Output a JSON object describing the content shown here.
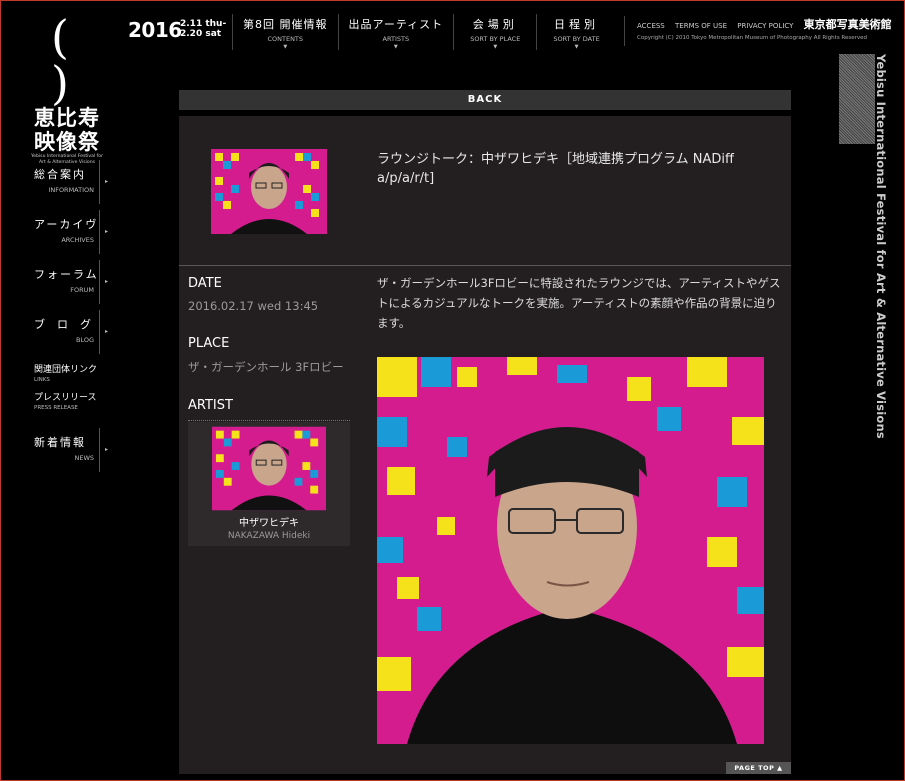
{
  "logo": {
    "paren": "( )",
    "jp_line1": "恵比寿",
    "jp_line2": "映像祭",
    "en_line1": "Yebisu International Festival for",
    "en_line2": "Art & Alternative Visions"
  },
  "top": {
    "year": "2016",
    "dates_line1": "2.11 thu-",
    "dates_line2": "2.20 sat",
    "nav": [
      {
        "jp": "第8回 開催情報",
        "en": "CONTENTS"
      },
      {
        "jp": "出品アーティスト",
        "en": "ARTISTS"
      },
      {
        "jp": "会場別",
        "en": "SORT BY PLACE"
      },
      {
        "jp": "日程別",
        "en": "SORT BY DATE"
      }
    ],
    "links": {
      "access": "ACCESS",
      "terms": "TERMS OF USE",
      "privacy": "PRIVACY POLICY",
      "museum": "東京都写真美術館",
      "copyright": "Copyright (C) 2010 Tokyo Metropolitan Museum of Photography All Rights Reserved"
    }
  },
  "side_nav": [
    {
      "jp": "総合案内",
      "en": "INFORMATION"
    },
    {
      "jp": "アーカイヴ",
      "en": "ARCHIVES"
    },
    {
      "jp": "フォーラム",
      "en": "FORUM"
    },
    {
      "jp": "ブログ",
      "en": "BLOG"
    }
  ],
  "side_small": [
    {
      "jp": "関連団体リンク",
      "en": "LINKS"
    },
    {
      "jp": "プレスリリース",
      "en": "PRESS RELEASE"
    }
  ],
  "side_news": {
    "jp": "新着情報",
    "en": "NEWS"
  },
  "vertical_text": "Yebisu International Festival for Art & Alternative Visions",
  "back": "BACK",
  "event": {
    "title": "ラウンジトーク：中ザワヒデキ［地域連携プログラム NADiff a/p/a/r/t]",
    "date_label": "DATE",
    "date": "2016.02.17 wed 13:45",
    "place_label": "PLACE",
    "place": "ザ・ガーデンホール 3Fロビー",
    "artist_label": "ARTIST",
    "artist_jp": "中ザワヒデキ",
    "artist_en": "NAKAZAWA Hideki",
    "description": "ザ・ガーデンホール3Fロビーに特設されたラウンジでは、アーティストやゲストによるカジュアルなトークを実施。アーティストの素顔や作品の背景に迫ります。"
  },
  "page_top": "PAGE TOP ▲",
  "colors": {
    "panel": "#231f20",
    "magenta": "#d41c8f",
    "yellow": "#f5e21b",
    "blue": "#1a9ad6"
  }
}
